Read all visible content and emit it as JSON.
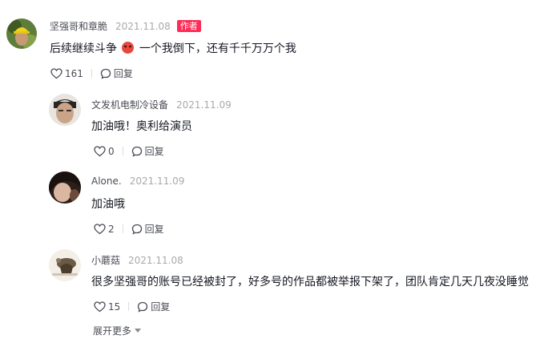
{
  "comments": [
    {
      "author": "坚强哥和章脆",
      "date": "2021.11.08",
      "badge": "作者",
      "text_before": "后续继续斗争",
      "emoji_icon": "angry-face-icon",
      "text_after": "一个我倒下，还有千千万万个我",
      "likes": "161",
      "reply_label": "回复"
    },
    {
      "author": "文发机电制冷设备",
      "date": "2021.11.09",
      "text": "加油哦！奥利给演员",
      "likes": "0",
      "reply_label": "回复"
    },
    {
      "author": "Alone.",
      "date": "2021.11.09",
      "text": "加油哦",
      "likes": "2",
      "reply_label": "回复"
    },
    {
      "author": "小蘑菇",
      "date": "2021.11.08",
      "text": "很多坚强哥的账号已经被封了，好多号的作品都被举报下架了，团队肯定几天几夜没睡觉",
      "likes": "15",
      "reply_label": "回复"
    }
  ],
  "expand_more_label": "展开更多",
  "colors": {
    "badge": "#fe2c55",
    "text": "#161823",
    "muted": "#a8a9ae"
  }
}
